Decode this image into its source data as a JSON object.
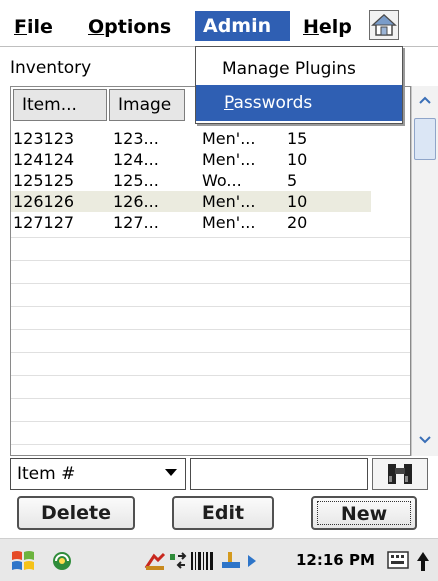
{
  "menubar": {
    "file": {
      "u": "F",
      "rest": "ile"
    },
    "options": {
      "u": "O",
      "rest": "ptions"
    },
    "admin": "Admin",
    "help": {
      "u": "H",
      "rest": "elp"
    },
    "home_icon": "home-icon"
  },
  "admin_menu": {
    "items": [
      {
        "label": "Manage Plugins"
      },
      {
        "u": "P",
        "rest": "asswords",
        "selected": true
      }
    ]
  },
  "inventory": {
    "label": "Inventory",
    "columns": [
      "Item...",
      "Image"
    ],
    "rows": [
      {
        "item": "123123",
        "image": "123...",
        "desc": "Men'...",
        "qty": "15",
        "highlight": false
      },
      {
        "item": "124124",
        "image": "124...",
        "desc": "Men'...",
        "qty": "10",
        "highlight": false
      },
      {
        "item": "125125",
        "image": "125...",
        "desc": "Wo...",
        "qty": "5",
        "highlight": false
      },
      {
        "item": "126126",
        "image": "126...",
        "desc": "Men'...",
        "qty": "10",
        "highlight": true
      },
      {
        "item": "127127",
        "image": "127...",
        "desc": "Men'...",
        "qty": "20",
        "highlight": false
      }
    ]
  },
  "search": {
    "field_selected": "Item #",
    "query": "",
    "find_icon": "binoculars-icon"
  },
  "actions": {
    "delete": "Delete",
    "edit": "Edit",
    "new": "New"
  },
  "taskbar": {
    "time": "12:16 PM"
  },
  "colors": {
    "menu_highlight": "#2f5fb3",
    "row_highlight": "#ebebdf"
  }
}
